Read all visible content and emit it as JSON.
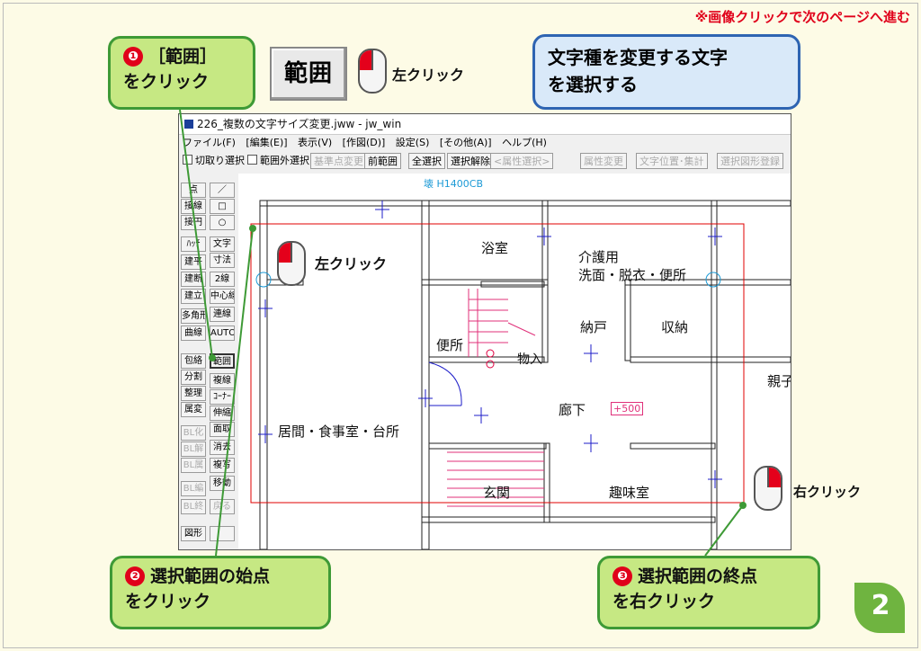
{
  "top_note": "※画像クリックで次のページへ進む",
  "callout1": {
    "num": "❶",
    "line1": "［範囲］",
    "line2": "をクリック"
  },
  "hanni_button_label": "範囲",
  "left_click_label": "左クリック",
  "right_click_label": "右クリック",
  "blue_callout": {
    "line1": "文字種を変更する文字",
    "line2": "を選択する"
  },
  "callout2": {
    "num": "❷",
    "line1": "選択範囲の始点",
    "line2": "をクリック"
  },
  "callout3": {
    "num": "❸",
    "line1": "選択範囲の終点",
    "line2": "を右クリック"
  },
  "page_number": "2",
  "window": {
    "title": "226_複数の文字サイズ変更.jww - jw_win",
    "menu": [
      "ファイル(F)",
      "[編集(E)]",
      "表示(V)",
      "[作図(D)]",
      "設定(S)",
      "[その他(A)]",
      "ヘルプ(H)"
    ],
    "toolbar": {
      "chk_cut": "切取り選択",
      "chk_outside": "範囲外選択",
      "btn_base": "基準点変更",
      "btn_prev": "前範囲",
      "btn_all": "全選択",
      "btn_release": "選択解除",
      "btn_attr_sel": "<属性選択>",
      "btn_attr_change": "属性変更",
      "btn_text_pos": "文字位置･集計",
      "btn_shape_reg": "選択図形登録"
    },
    "sidebar_left": [
      "点",
      "接線",
      "接円",
      "ﾊｯﾁ",
      "建平",
      "建断",
      "建立",
      "多角形",
      "曲線",
      "包絡",
      "分割",
      "整理",
      "属変",
      "BL化",
      "BL解",
      "BL属",
      "BL編",
      "BL終",
      "図形"
    ],
    "sidebar_right": [
      "／",
      "□",
      "○",
      "文字",
      "寸法",
      "2線",
      "中心線",
      "連線",
      "AUTO",
      "範囲",
      "複線",
      "ｺｰﾅｰ",
      "伸縮",
      "面取",
      "消去",
      "複写",
      "移動",
      "戻る",
      ""
    ],
    "rooms": {
      "bath": "浴室",
      "care": "介護用",
      "care2": "洗面・脱衣・便所",
      "closet": "納戸",
      "storage": "収納",
      "toilet": "便所",
      "mono": "物入",
      "hall": "廊下",
      "living": "居間・食事室・台所",
      "entry": "玄関",
      "hobby": "趣味室",
      "parent": "親子",
      "header_text": "壊 H1400CB",
      "plus500": "+500"
    }
  }
}
